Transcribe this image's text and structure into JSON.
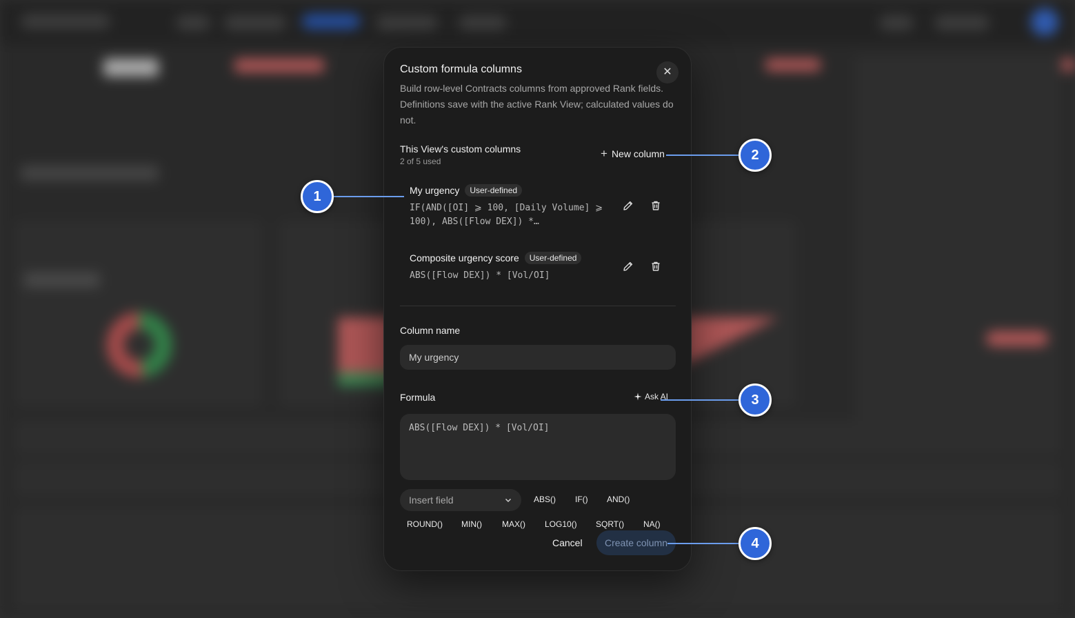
{
  "modal": {
    "title": "Custom formula columns",
    "description": "Build row-level Contracts columns from approved Rank fields. Definitions save with the active Rank View; calculated values do not.",
    "close_icon": "close-icon"
  },
  "custom_columns": {
    "section_title": "This View's custom columns",
    "usage": "2 of 5 used",
    "new_column_label": "New column",
    "items": [
      {
        "name": "My urgency",
        "badge": "User-defined",
        "formula": "IF(AND([OI] ⩾ 100, [Daily Volume] ⩾ 100), ABS([Flow DEX]) *…"
      },
      {
        "name": "Composite urgency score",
        "badge": "User-defined",
        "formula": "ABS([Flow DEX]) * [Vol/OI]"
      }
    ]
  },
  "form": {
    "column_name_label": "Column name",
    "column_name_value": "My urgency",
    "formula_label": "Formula",
    "ask_ai_label": "Ask AI",
    "formula_value": "ABS([Flow DEX]) * [Vol/OI]",
    "insert_field_label": "Insert field",
    "functions": [
      "ABS()",
      "IF()",
      "AND()",
      "ROUND()",
      "MIN()",
      "MAX()",
      "LOG10()",
      "SQRT()",
      "NA()"
    ],
    "cancel_label": "Cancel",
    "create_label": "Create column"
  },
  "callouts": [
    "1",
    "2",
    "3",
    "4"
  ],
  "colors": {
    "modal_bg": "#1c1c1c",
    "callout_blue": "#2f66d9",
    "callout_line": "#6b9ded",
    "create_disabled": "#223044"
  }
}
